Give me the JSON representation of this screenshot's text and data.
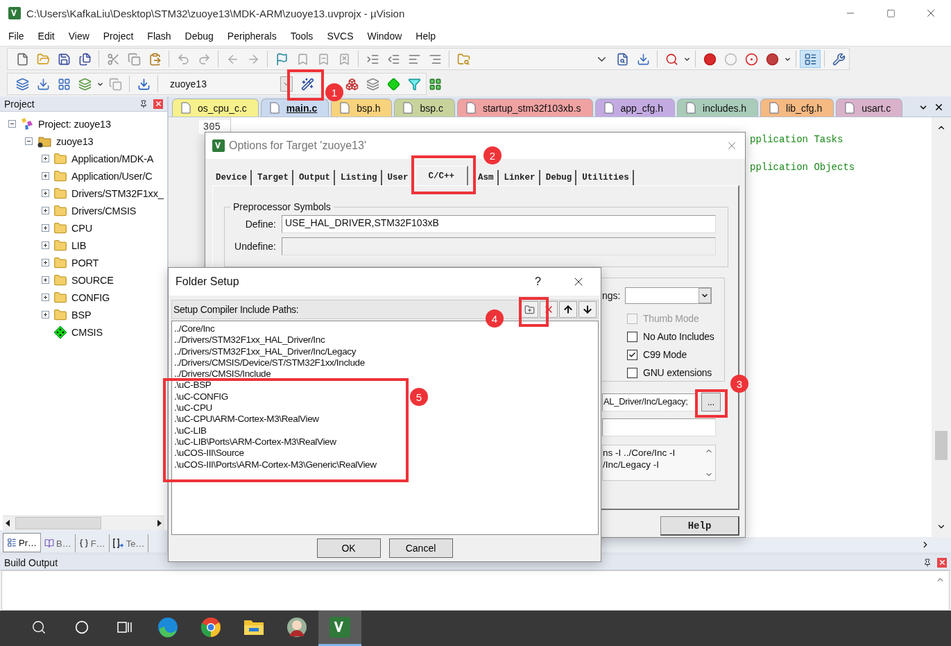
{
  "window": {
    "title": "C:\\Users\\KafkaLiu\\Desktop\\STM32\\zuoye13\\MDK-ARM\\zuoye13.uvprojx - µVision"
  },
  "menu": [
    "File",
    "Edit",
    "View",
    "Project",
    "Flash",
    "Debug",
    "Peripherals",
    "Tools",
    "SVCS",
    "Window",
    "Help"
  ],
  "toolbar": {
    "target": "zuoye13"
  },
  "project_panel": {
    "title": "Project",
    "tree": [
      {
        "label": "Project: zuoye13",
        "kind": "root",
        "expanded": true,
        "children": [
          {
            "label": "zuoye13",
            "kind": "target",
            "expanded": true,
            "children": [
              {
                "label": "Application/MDK-A",
                "kind": "folder",
                "expanded": false
              },
              {
                "label": "Application/User/C",
                "kind": "folder",
                "expanded": false
              },
              {
                "label": "Drivers/STM32F1xx_",
                "kind": "folder",
                "expanded": false
              },
              {
                "label": "Drivers/CMSIS",
                "kind": "folder",
                "expanded": false
              },
              {
                "label": "CPU",
                "kind": "folder",
                "expanded": false
              },
              {
                "label": "LIB",
                "kind": "folder",
                "expanded": false
              },
              {
                "label": "PORT",
                "kind": "folder",
                "expanded": false
              },
              {
                "label": "SOURCE",
                "kind": "folder",
                "expanded": false
              },
              {
                "label": "CONFIG",
                "kind": "folder",
                "expanded": false
              },
              {
                "label": "BSP",
                "kind": "folder",
                "expanded": false
              },
              {
                "label": "CMSIS",
                "kind": "component"
              }
            ]
          }
        ]
      }
    ],
    "tabs": [
      {
        "label": "Pr…",
        "kind": "project",
        "selected": true
      },
      {
        "label": "B…",
        "kind": "books",
        "selected": false
      },
      {
        "label": "F…",
        "kind": "functions",
        "selected": false
      },
      {
        "label": "Te…",
        "kind": "templates",
        "selected": false
      }
    ]
  },
  "editor": {
    "tabs": [
      {
        "label": "os_cpu_c.c",
        "color": "#f6f18c",
        "selected": false
      },
      {
        "label": "main.c",
        "color": "#c9d9ef",
        "selected": true
      },
      {
        "label": "bsp.h",
        "color": "#f8d27c",
        "selected": false
      },
      {
        "label": "bsp.c",
        "color": "#c8d39c",
        "selected": false
      },
      {
        "label": "startup_stm32f103xb.s",
        "color": "#f0a2a2",
        "selected": false
      },
      {
        "label": "app_cfg.h",
        "color": "#c3abe2",
        "selected": false
      },
      {
        "label": "includes.h",
        "color": "#a9ccb9",
        "selected": false
      },
      {
        "label": "lib_cfg.h",
        "color": "#f5b982",
        "selected": false
      },
      {
        "label": "usart.c",
        "color": "#d9b2c9",
        "selected": false
      }
    ],
    "line_number": "305",
    "code_lines": [
      "pplication Tasks",
      "pplication Objects"
    ]
  },
  "options_dialog": {
    "title": "Options for Target 'zuoye13'",
    "tabs": [
      {
        "label": "Device",
        "selected": false
      },
      {
        "label": "Target",
        "selected": false
      },
      {
        "label": "Output",
        "selected": false
      },
      {
        "label": "Listing",
        "selected": false
      },
      {
        "label": "User",
        "selected": false
      },
      {
        "label": "C/C++",
        "selected": true
      },
      {
        "label": "Asm",
        "selected": false
      },
      {
        "label": "Linker",
        "selected": false
      },
      {
        "label": "Debug",
        "selected": false
      },
      {
        "label": "Utilities",
        "selected": false
      }
    ],
    "group_title": "Preprocessor Symbols",
    "define_label": "Define:",
    "define": "USE_HAL_DRIVER,STM32F103xB",
    "undefine_label": "Undefine:",
    "warnings_label": "ngs:",
    "checkboxes": [
      {
        "label": "Thumb Mode",
        "checked": false,
        "disabled": true
      },
      {
        "label": "No Auto Includes",
        "checked": false,
        "disabled": false
      },
      {
        "label": "C99 Mode",
        "checked": true,
        "disabled": false
      },
      {
        "label": "GNU extensions",
        "checked": false,
        "disabled": false
      }
    ],
    "include_paths": "AL_Driver/Inc/Legacy;",
    "browse_button": "...",
    "compiler_string": [
      "ns -I ../Core/Inc -I",
      "/Inc/Legacy -I"
    ],
    "help_button": "Help"
  },
  "folder_dialog": {
    "title": "Folder Setup",
    "help": "?",
    "label": "Setup Compiler Include Paths:",
    "paths": [
      "../Core/Inc",
      "../Drivers/STM32F1xx_HAL_Driver/Inc",
      "../Drivers/STM32F1xx_HAL_Driver/Inc/Legacy",
      "../Drivers/CMSIS/Device/ST/STM32F1xx/Include",
      "../Drivers/CMSIS/Include",
      ".\\uC-BSP",
      ".\\uC-CONFIG",
      ".\\uC-CPU",
      ".\\uC-CPU\\ARM-Cortex-M3\\RealView",
      ".\\uC-LIB",
      ".\\uC-LIB\\Ports\\ARM-Cortex-M3\\RealView",
      ".\\uCOS-III\\Source",
      ".\\uCOS-III\\Ports\\ARM-Cortex-M3\\Generic\\RealView"
    ],
    "buttons": [
      "OK",
      "Cancel"
    ]
  },
  "build_output": {
    "title": "Build Output"
  },
  "annotations": [
    {
      "label": "1"
    },
    {
      "label": "2"
    },
    {
      "label": "3"
    },
    {
      "label": "4"
    },
    {
      "label": "5"
    }
  ]
}
